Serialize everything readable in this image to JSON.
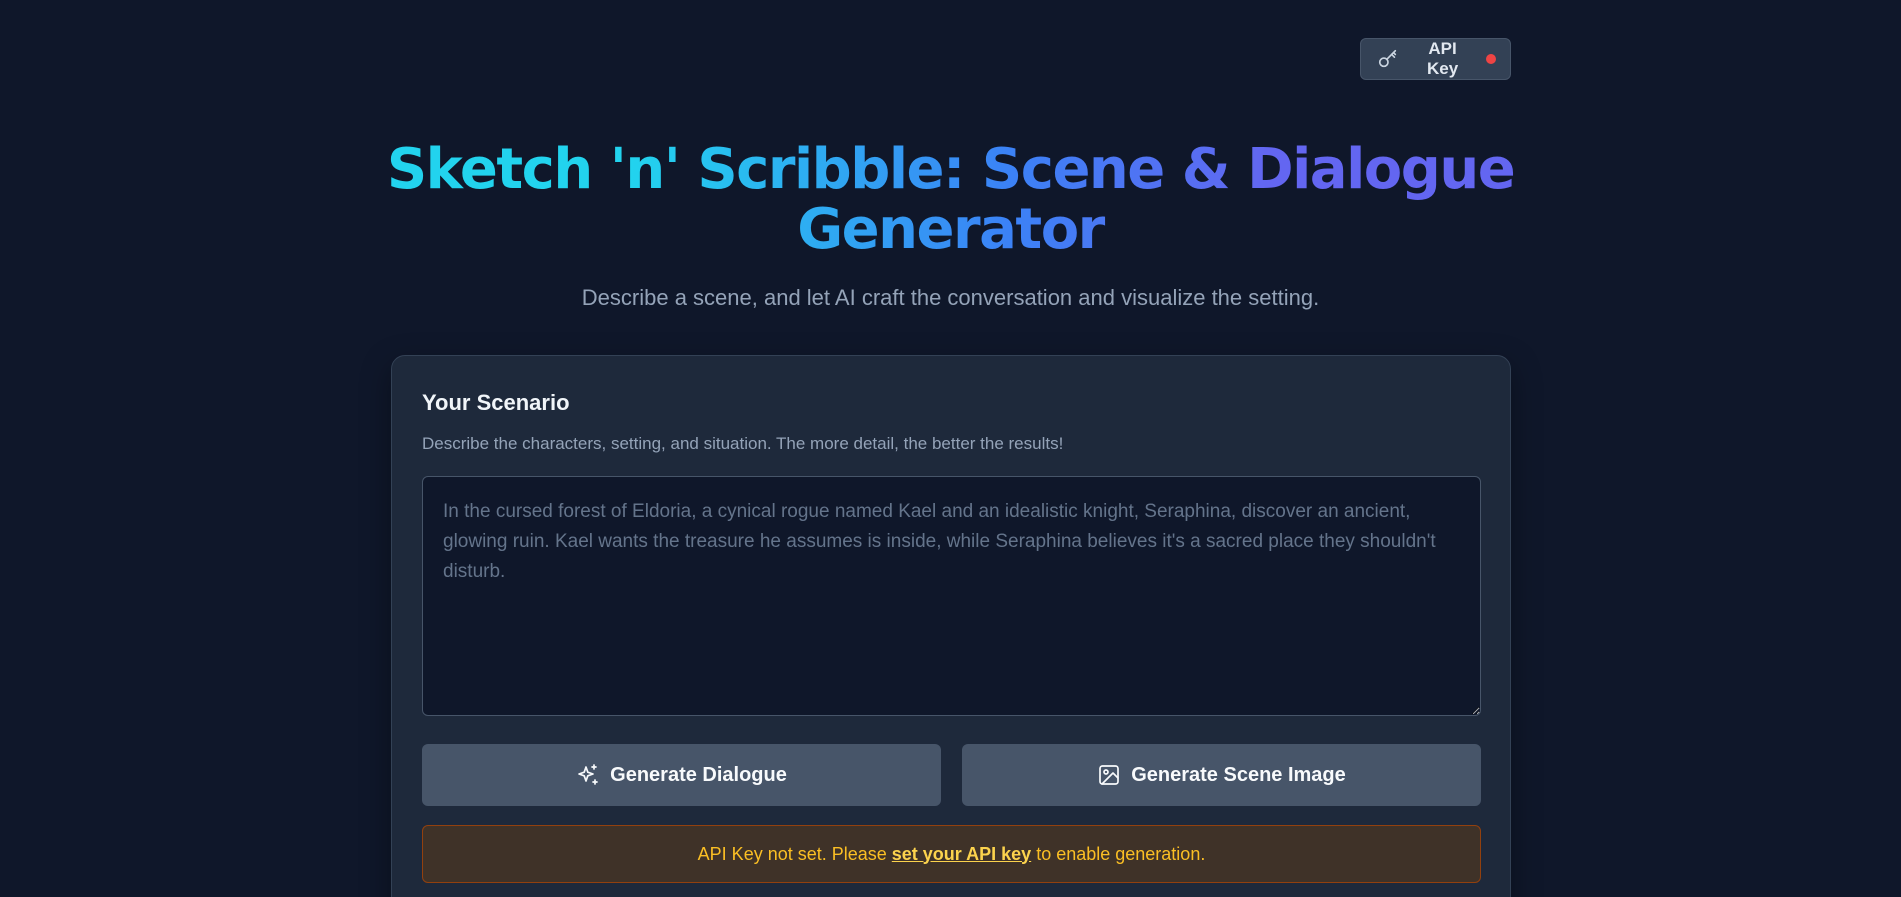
{
  "header": {
    "api_key_label": "API Key",
    "api_key_status_color": "#ef4444"
  },
  "hero": {
    "title": "Sketch 'n' Scribble: Scene & Dialogue Generator",
    "subtitle": "Describe a scene, and let AI craft the conversation and visualize the setting."
  },
  "scenario": {
    "heading": "Your Scenario",
    "description": "Describe the characters, setting, and situation. The more detail, the better the results!",
    "input_value": "",
    "input_placeholder": "In the cursed forest of Eldoria, a cynical rogue named Kael and an idealistic knight, Seraphina, discover an ancient, glowing ruin. Kael wants the treasure he assumes is inside, while Seraphina believes it's a sacred place they shouldn't disturb."
  },
  "actions": {
    "generate_dialogue_label": "Generate Dialogue",
    "generate_dialogue_icon": "sparkles-icon",
    "generate_image_label": "Generate Scene Image",
    "generate_image_icon": "image-icon"
  },
  "warning": {
    "prefix": "API Key not set. Please",
    "link": "set your API key",
    "suffix": "to enable generation."
  },
  "colors": {
    "background": "#0f172a",
    "card": "#1e293b",
    "title_gradient": [
      "#22d3ee",
      "#3b82f6",
      "#6366f1"
    ],
    "warning_text": "#fbbf24"
  }
}
